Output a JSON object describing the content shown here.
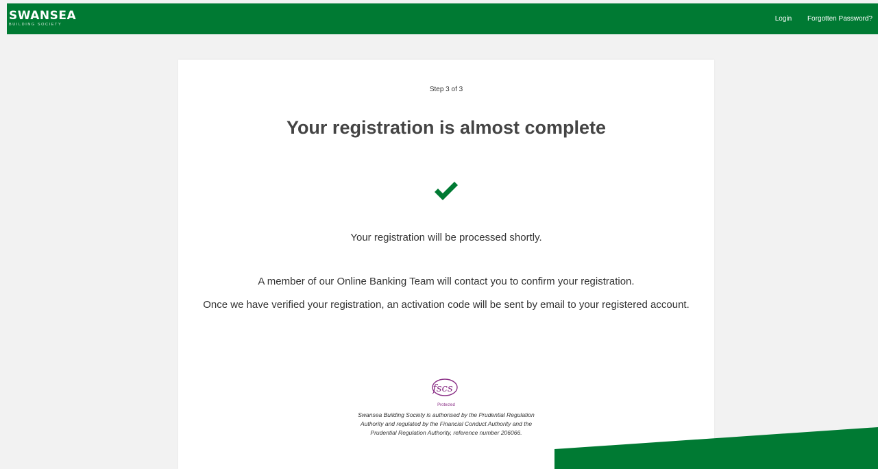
{
  "header": {
    "brand_name": "SWANSEA",
    "brand_sub": "BUILDING SOCIETY",
    "nav": {
      "login": "Login",
      "forgotten_password": "Forgotten Password?"
    }
  },
  "card": {
    "step": "Step 3 of 3",
    "title": "Your registration is almost complete",
    "status_icon": "checkmark-icon",
    "message_processed": "Your registration will be processed shortly.",
    "message_contact": "A member of our Online Banking Team will contact you to confirm your registration.",
    "message_activation": "Once we have verified your registration, an activation code will be sent by email to your registered account."
  },
  "footer": {
    "fscs_logo_text": "fscs",
    "fscs_label": "Protected",
    "legal_text": "Swansea Building Society is authorised by the Prudential Regulation Authority and regulated by the Financial Conduct Authority and the Prudential Regulation Authority, reference number 206066."
  },
  "colors": {
    "brand_green": "#007a33",
    "fscs_purple": "#8a2f86",
    "background": "#f2f2f2"
  }
}
